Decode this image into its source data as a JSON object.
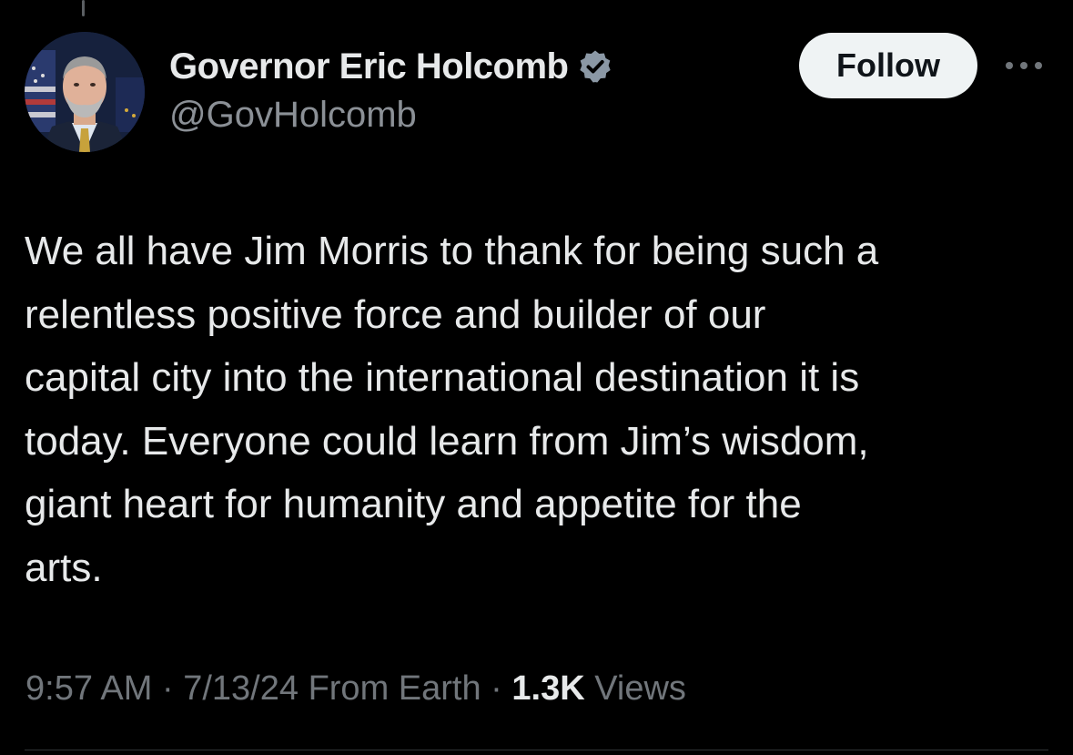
{
  "tweet": {
    "author": {
      "display_name": "Governor Eric Holcomb",
      "handle": "@GovHolcomb",
      "verified_icon": "verified-badge-icon",
      "verified_color": "#8b98a5"
    },
    "follow_label": "Follow",
    "more_icon": "more-options-icon",
    "text_lines": [
      "We all have Jim Morris to thank for being such a",
      "relentless positive force and builder of our",
      "capital city into the international destination it is",
      "today. Everyone could learn from Jim’s wisdom,",
      "giant heart for humanity and appetite for the",
      "arts."
    ],
    "meta": {
      "time": "9:57 AM",
      "separator": "·",
      "date": "7/13/24",
      "source": "From Earth",
      "views_count": "1.3K",
      "views_label": "Views"
    }
  },
  "colors": {
    "background": "#000000",
    "primary_text": "#e7e9ea",
    "secondary_text": "#71767b",
    "follow_button_bg": "#eff3f4"
  }
}
